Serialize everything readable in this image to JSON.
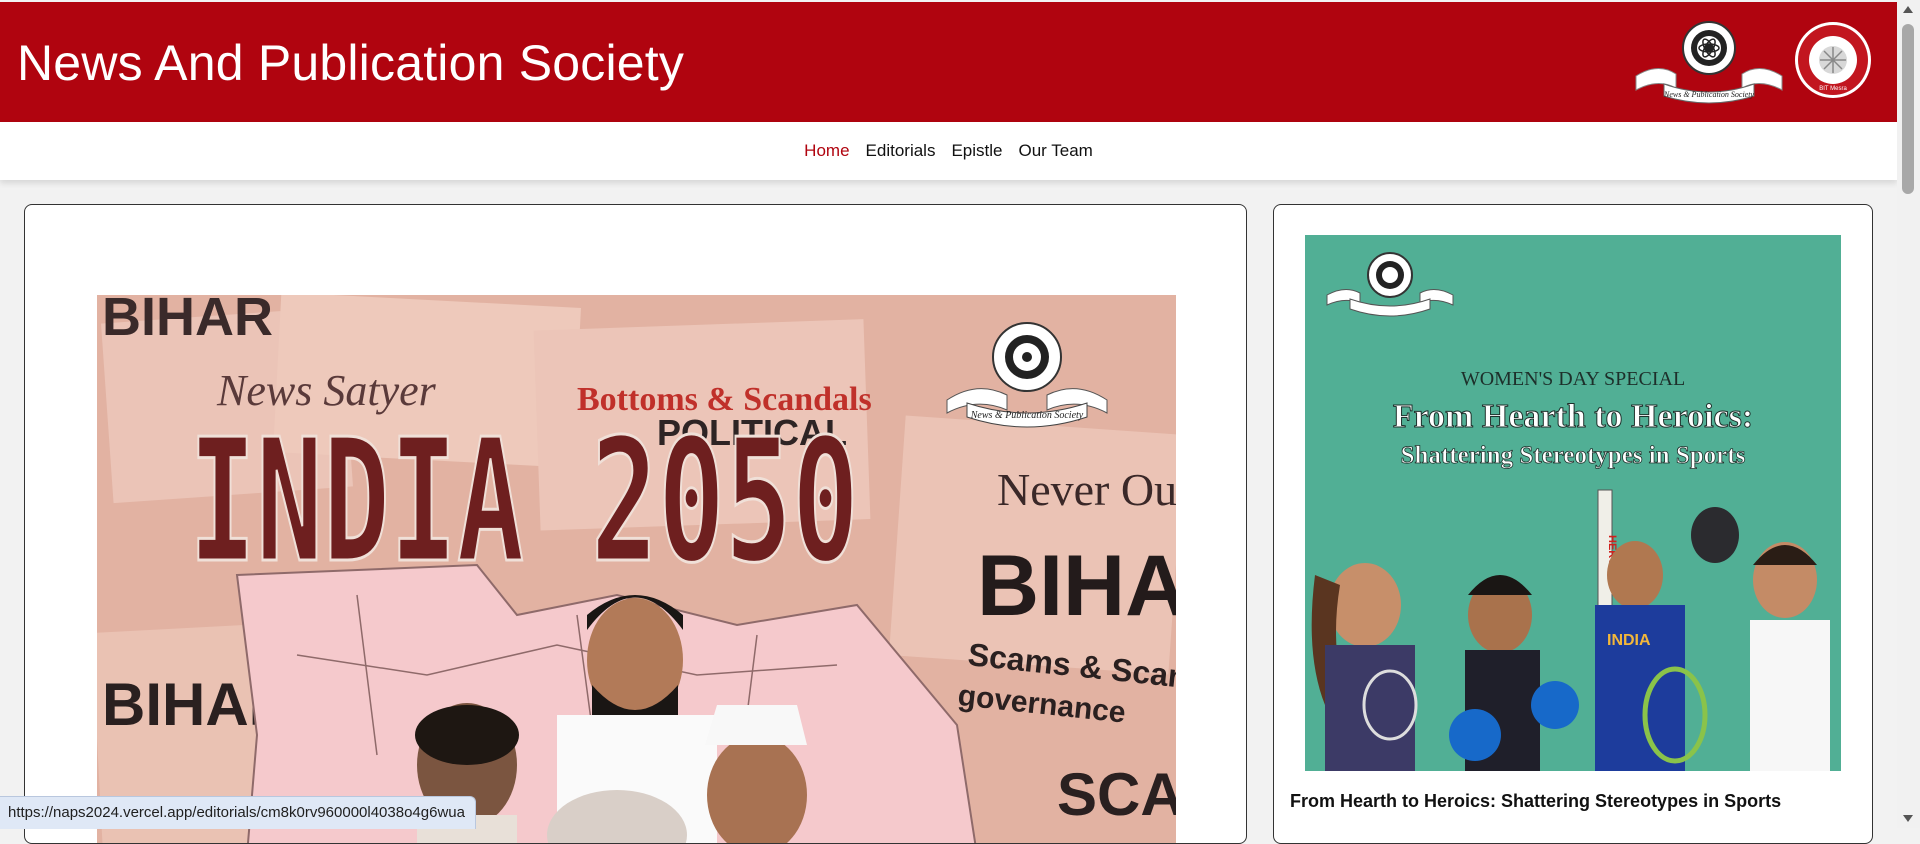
{
  "header": {
    "site_title": "News And Publication Society",
    "brand_color": "#b0040f",
    "logo_naps_text": "News & Publication Society",
    "logo_bit_text": "BIT Mesra"
  },
  "nav": {
    "items": [
      {
        "label": "Home",
        "active": true
      },
      {
        "label": "Editorials",
        "active": false
      },
      {
        "label": "Epistle",
        "active": false
      },
      {
        "label": "Our Team",
        "active": false
      }
    ],
    "active_color": "#b0040f"
  },
  "featured": {
    "poster_title": "INDIA 2050",
    "newspaper_words": [
      "BIHAR",
      "News Satyer",
      "Bottoms & Scandals",
      "POLITICAL",
      "Never Ou",
      "BIHA",
      "Scams & Scandals",
      "governance",
      "SCAM",
      "BIHAR"
    ],
    "watermark_text": "News & Publication Society"
  },
  "side_article": {
    "kicker": "WOMEN'S DAY SPECIAL",
    "poster_heading": "From Hearth to Heroics:",
    "poster_subheading": "Shattering Stereotypes in Sports",
    "title": "From Hearth to Heroics: Shattering Stereotypes in Sports",
    "jersey_text": "INDIA",
    "bat_text": "HERO"
  },
  "status_bar": {
    "url": "https://naps2024.vercel.app/editorials/cm8k0rv960000l4038o4g6wua"
  }
}
